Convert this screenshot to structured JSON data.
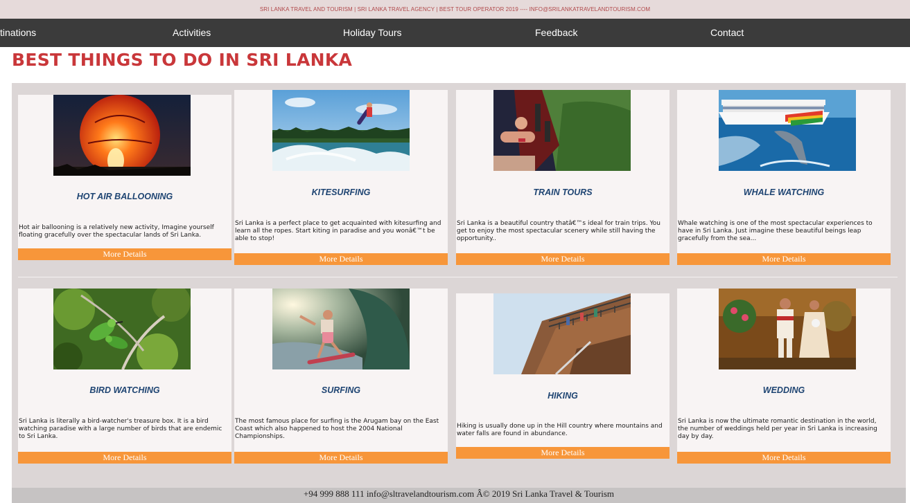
{
  "topbar": {
    "text": "SRI LANKA TRAVEL AND TOURISM | SRI LANKA TRAVEL AGENCY | BEST TOUR OPERATOR 2019 ---- INFO@SRILANKATRAVELANDTOURISM.COM"
  },
  "nav": {
    "items": [
      "tinations",
      "Activities",
      "Holiday Tours",
      "Feedback",
      "Contact"
    ]
  },
  "page": {
    "title": "BEST THINGS TO DO IN SRI LANKA"
  },
  "cards": [
    {
      "title": "HOT AIR BALLOONING",
      "desc": "Hot air ballooning is a relatively new activity, Imagine yourself floating gracefully over the spectacular lands of Sri Lanka.",
      "button": "More Details",
      "image_icon": "hot-air-balloon-photo"
    },
    {
      "title": "KITESURFING",
      "desc": "Sri Lanka is a perfect place to get acquainted with kitesurfing and learn all the ropes. Start kiting in paradise and you wonâ€™t be able to stop!",
      "button": "More Details",
      "image_icon": "kitesurfer-photo"
    },
    {
      "title": "TRAIN TOURS",
      "desc": "Sri Lanka is a beautiful country thatâ€™s ideal for train trips. You get to enjoy the most spectacular scenery while still having the opportunity..",
      "button": "More Details",
      "image_icon": "train-photo"
    },
    {
      "title": "WHALE WATCHING",
      "desc": "Whale watching is one of the most spectacular experiences to have in Sri Lanka. Just imagine these beautiful beings leap gracefully from the sea...",
      "button": "More Details",
      "image_icon": "whale-boat-photo"
    },
    {
      "title": "BIRD WATCHING",
      "desc": "Sri Lanka is literally a bird-watcher's treasure box. It is a bird watching paradise with a large number of birds that are endemic to Sri Lanka.",
      "button": "More Details",
      "image_icon": "bee-eater-bird-photo"
    },
    {
      "title": "SURFING",
      "desc": "The most famous place for surfing is the Arugam bay on the East Coast which also happened to host the 2004 National Championships.",
      "button": "More Details",
      "image_icon": "surfer-wave-photo"
    },
    {
      "title": "HIKING",
      "desc": "Hiking is usually done up in the Hill country where mountains and water falls are found in abundance.",
      "button": "More Details",
      "image_icon": "rock-staircase-photo"
    },
    {
      "title": "WEDDING",
      "desc": "Sri Lanka is now the ultimate romantic destination in the world, the number of weddings held per year in Sri Lanka is increasing day by day.",
      "button": "More Details",
      "image_icon": "wedding-couple-photo"
    }
  ],
  "footer": {
    "text": "+94 999 888 111 info@sltravelandtourism.com Â© 2019 Sri Lanka Travel & Tourism"
  },
  "colors": {
    "title_red": "#c9373a",
    "card_title_blue": "#1e4472",
    "button_orange": "#f7963a",
    "nav_bg": "#3b3b3b"
  }
}
